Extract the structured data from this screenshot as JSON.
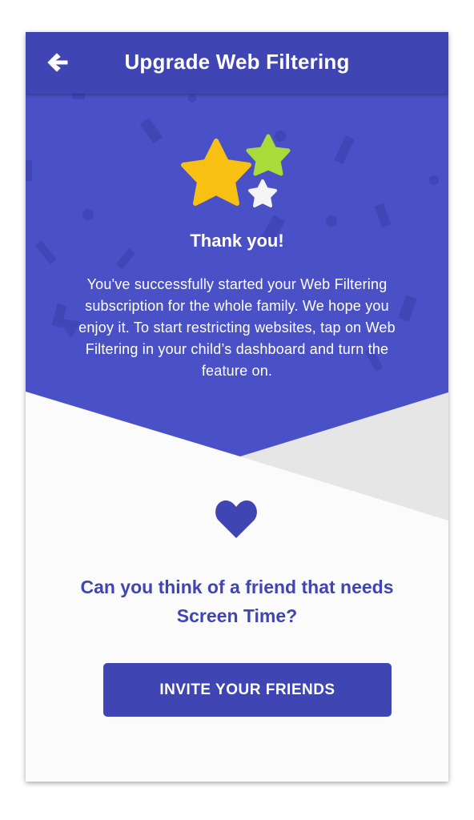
{
  "header": {
    "title": "Upgrade Web Filtering",
    "back_icon": "arrow-left-icon"
  },
  "celebration": {
    "heading": "Thank you!",
    "message": "You've successfully started your Web Filtering subscription for the whole family. We hope you enjoy it. To start restricting websites, tap on Web Filtering in your child’s dashboard and turn the feature on.",
    "icons": [
      "star-gold-icon",
      "star-green-icon",
      "star-white-icon"
    ]
  },
  "referral": {
    "icon": "heart-icon",
    "question": "Can you think of a friend that needs Screen Time?",
    "button_label": "INVITE YOUR FRIENDS"
  },
  "colors": {
    "primary": "#3f45b3",
    "hero": "#4a50c5",
    "star_gold": "#f7c012",
    "star_green": "#a8dc3a",
    "star_white": "#f5f5f5",
    "background": "#fbfbfb",
    "panel_gray": "#e6e6e6"
  }
}
